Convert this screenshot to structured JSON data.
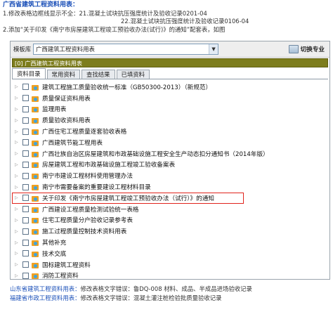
{
  "notice": {
    "title": "广西省建筑工程资料用表：",
    "line1": "1.修改表格边框线显示不全：21.混凝土试块抗压强度统计及验收记录0201-04",
    "line2": "22.混凝土试块抗压强度统计及验收记录0106-04",
    "line3": "2.添加“关于印发《南宁市房屋建筑工程竣工预验收办法(试行)》的通知”配套表，如图"
  },
  "app": {
    "toolbar": {
      "label": "模板库",
      "combo_value": "广西建筑工程资料用表",
      "switch_label": "切换专业"
    },
    "selected_path": "[0] 广西建筑工程资料用表",
    "tabs": [
      "资料目录",
      "常用资料",
      "查找结果",
      "已填资料"
    ],
    "tree_items": [
      "建筑工程施工质量验收统一标准（GB50300-2013）（新规范）",
      "质量保证资料用表",
      "监理用表",
      "质量验收资料用表",
      "广西住宅工程质量逐套验收表格",
      "广西建筑节能工程用表",
      "广西壮族自治区房屋建筑和市政基础设施工程安全生产动态扣分通知书（2014年版）",
      "房屋建筑工程和市政基础设施工程竣工验收备案表",
      "南宁市建设工程材料使用管理办法",
      "南宁市需要备案的重要建设工程材料目录",
      "关于印发《南宁市房屋建筑工程竣工预验收办法（试行）》的通知",
      "广西建设工程质量检测试验统一表格",
      "住宅工程质量分户验收记录参考表",
      "施工过程质量控制技术资料用表",
      "其他补充",
      "技术交底",
      "国标建筑工程资料",
      "消防工程资料",
      "人防防空工程"
    ],
    "highlighted_index": 10
  },
  "footer": {
    "line1_head": "山东省建筑工程资料用表：",
    "line1_body": "修改表格文字错误：鲁DQ-008  材料、成品、半成品进场验收记录",
    "line2_head": "福建省市政工程资料用表：",
    "line2_body": "修改表格文字错误：混凝土灌注桩检验批质量验收记录"
  },
  "colors": {
    "accent_blue": "#1a4fb8",
    "selection_olive": "#7d7d1d",
    "highlight_red": "#e1231c",
    "folder_orange": "#f0a020"
  }
}
